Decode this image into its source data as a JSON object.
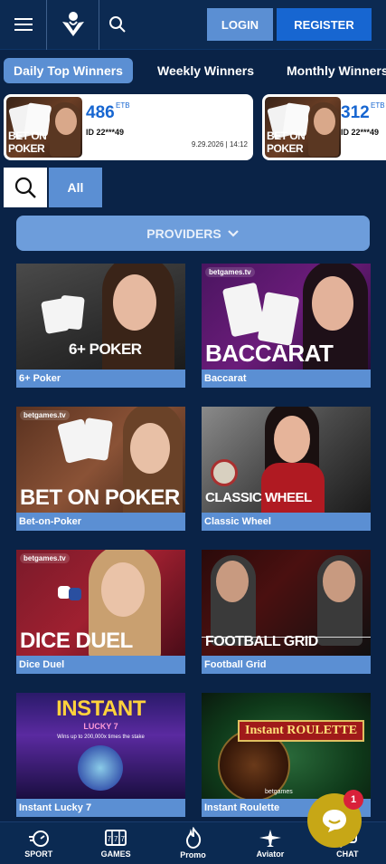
{
  "header": {
    "login_label": "LOGIN",
    "register_label": "REGISTER"
  },
  "winner_tabs": [
    {
      "label": "Daily Top Winners",
      "active": true
    },
    {
      "label": "Weekly Winners",
      "active": false
    },
    {
      "label": "Monthly Winners",
      "active": false
    }
  ],
  "winners": [
    {
      "game": "BET ON POKER",
      "amount": "486",
      "currency": "ETB",
      "id": "ID 22***49",
      "datetime": "9.29.2026 | 14:12"
    },
    {
      "game": "BET ON POKER",
      "amount": "312",
      "currency": "ETB",
      "id": "ID 22***49"
    }
  ],
  "filters": {
    "all_label": "All",
    "providers_label": "PROVIDERS"
  },
  "games": [
    {
      "name": "6+ Poker",
      "art_text": "6+ POKER"
    },
    {
      "name": "Baccarat",
      "art_text": "BACCARAT",
      "brand": "betgames.tv"
    },
    {
      "name": "Bet-on-Poker",
      "art_text": "BET ON POKER",
      "brand": "betgames.tv"
    },
    {
      "name": "Classic Wheel",
      "art_text": "CLASSIC WHEEL"
    },
    {
      "name": "Dice Duel",
      "art_text": "DICE DUEL",
      "brand": "betgames.tv"
    },
    {
      "name": "Football Grid",
      "art_text": "FOOTBALL GRID"
    },
    {
      "name": "Instant Lucky 7",
      "art_text": "INSTANT",
      "art_sub": "LUCKY 7",
      "art_note": "Wins up to 200,000x times the stake"
    },
    {
      "name": "Instant Roulette",
      "art_text": "Instant ROULETTE",
      "brand": "betgames"
    }
  ],
  "bottom_nav": [
    {
      "label": "SPORT",
      "icon": "stopwatch-icon"
    },
    {
      "label": "GAMES",
      "icon": "slot-machine-icon"
    },
    {
      "label": "Promo",
      "icon": "flame-icon"
    },
    {
      "label": "Aviator",
      "icon": "airplane-icon"
    },
    {
      "label": "CHAT",
      "icon": "chat-icon"
    }
  ],
  "chat": {
    "badge_count": "1"
  },
  "colors": {
    "background": "#0a2347",
    "accent": "#5b8fd3",
    "primary": "#1766d1",
    "chat_fab": "#c7a716",
    "badge": "#d9213a"
  }
}
